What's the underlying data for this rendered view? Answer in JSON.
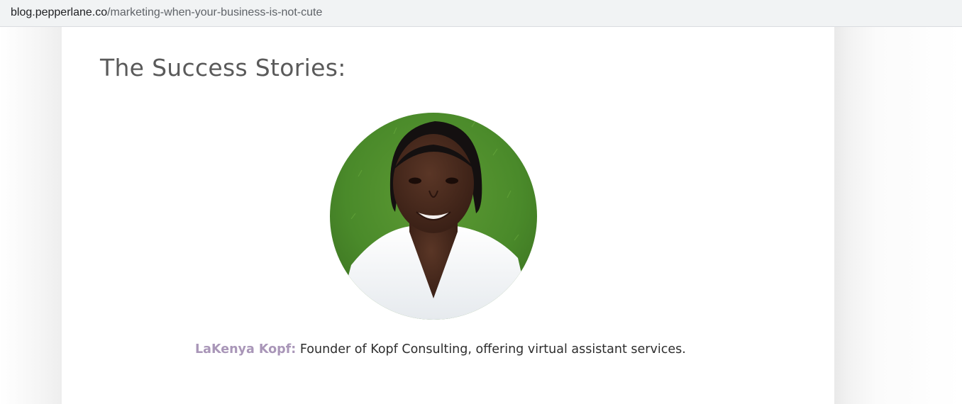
{
  "browser": {
    "url_domain": "blog.pepperlane.co",
    "url_path": "/marketing-when-your-business-is-not-cute"
  },
  "article": {
    "section_title": "The Success Stories:",
    "story": {
      "photo": "portrait-photo",
      "name": "LaKenya Kopf:",
      "description": " Founder of Kopf Consulting, offering virtual assistant services."
    }
  },
  "colors": {
    "name_accent": "#a996b8",
    "title_text": "#5a5a5a",
    "body_text": "#2d2d2d"
  }
}
